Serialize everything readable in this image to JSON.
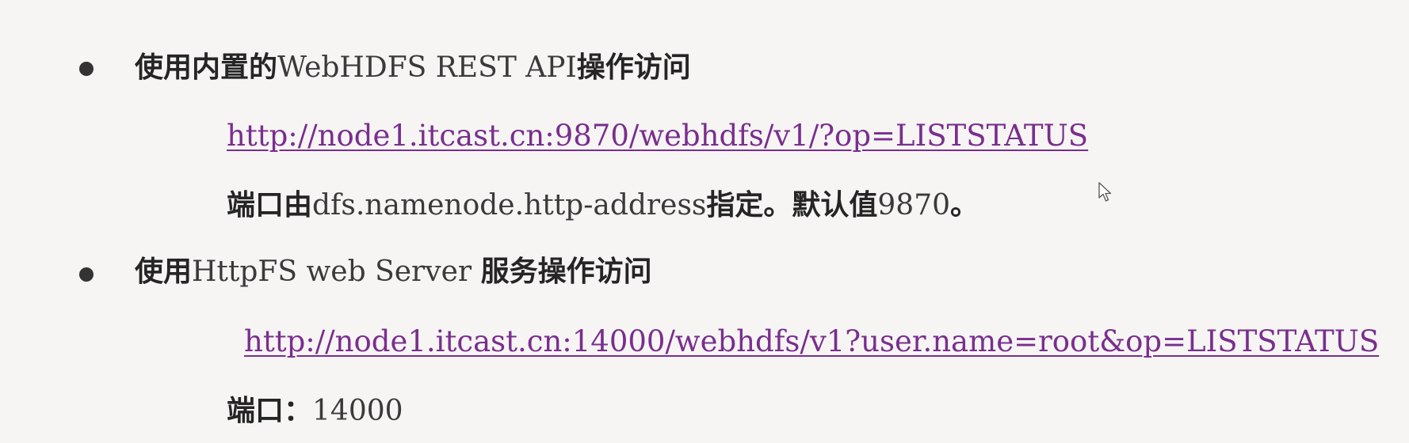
{
  "items": [
    {
      "heading_cn_prefix": "使用内置的",
      "heading_latin": "WebHDFS REST API",
      "heading_cn_suffix": "操作访问",
      "link": "http://node1.itcast.cn:9870/webhdfs/v1/?op=LISTSTATUS",
      "note_cn_prefix": "端口由",
      "note_latin": "dfs.namenode.http-address",
      "note_cn_middle": "指定。默认值",
      "note_number": "9870",
      "note_cn_suffix": "。"
    },
    {
      "heading_cn_prefix": "使用",
      "heading_latin": "HttpFS web Server ",
      "heading_cn_suffix": "服务操作访问",
      "link": "http://node1.itcast.cn:14000/webhdfs/v1?user.name=root&op=LISTSTATUS",
      "note_cn_prefix": "端口",
      "note_sep": "：",
      "note_number": "14000"
    }
  ],
  "colors": {
    "link": "#7a2e8e",
    "background": "#f6f5f4",
    "text": "#2b2b2b"
  },
  "icons": {
    "bullet": "bullet-dot-icon",
    "cursor": "mouse-pointer-icon"
  }
}
